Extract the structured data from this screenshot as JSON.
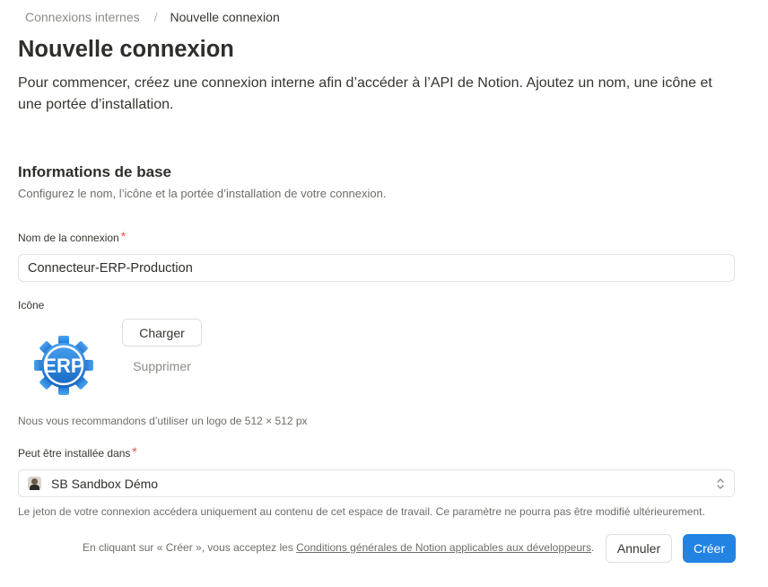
{
  "breadcrumb": {
    "parent": "Connexions internes",
    "separator": "/",
    "current": "Nouvelle connexion"
  },
  "page": {
    "title": "Nouvelle connexion",
    "intro": "Pour commencer, créez une connexion interne afin d’accéder à l’API de Notion. Ajoutez un nom, une icône et une portée d’installation."
  },
  "section": {
    "title": "Informations de base",
    "subtitle": "Configurez le nom, l’icône et la portée d’installation de votre connexion."
  },
  "name_field": {
    "label": "Nom de la connexion",
    "required_mark": "*",
    "value": "Connecteur-ERP-Production"
  },
  "icon_field": {
    "label": "Icône",
    "logo_text": "ERP",
    "logo_icon": "gear-icon",
    "upload_label": "Charger",
    "remove_label": "Supprimer",
    "hint": "Nous vous recommandons d’utiliser un logo de 512 × 512 px"
  },
  "workspace_field": {
    "label": "Peut être installée dans",
    "required_mark": "*",
    "selected": "SB Sandbox Démo",
    "hint": "Le jeton de votre connexion accédera uniquement au contenu de cet espace de travail. Ce paramètre ne pourra pas être modifié ultérieurement."
  },
  "footer": {
    "terms_prefix": "En cliquant sur « Créer », vous acceptez les ",
    "terms_link": "Conditions générales de Notion applicables aux développeurs",
    "terms_suffix": ".",
    "cancel_label": "Annuler",
    "create_label": "Créer"
  },
  "colors": {
    "primary": "#2383e2",
    "required": "#e5534b",
    "logo_blue": "#1e78d6"
  }
}
